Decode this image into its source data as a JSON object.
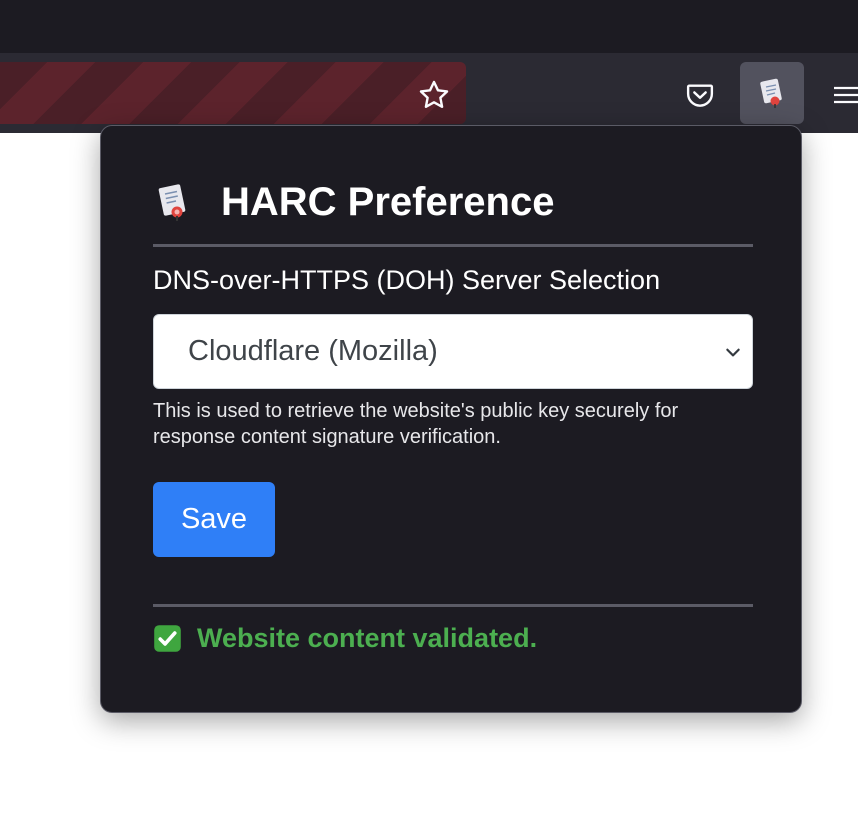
{
  "popup": {
    "title": "HARC Preference",
    "dns_label": "DNS-over-HTTPS (DOH) Server Selection",
    "dns_selected": "Cloudflare (Mozilla)",
    "help_text": "This is used to retrieve the website's public key securely for response content signature verification.",
    "save_label": "Save",
    "status_text": "Website content validated.",
    "status_color": "#4caf50",
    "accent_color": "#2f7ff7"
  },
  "toolbar": {
    "icons": [
      "star-icon",
      "pocket-icon",
      "harc-extension-icon",
      "hamburger-menu-icon"
    ]
  }
}
